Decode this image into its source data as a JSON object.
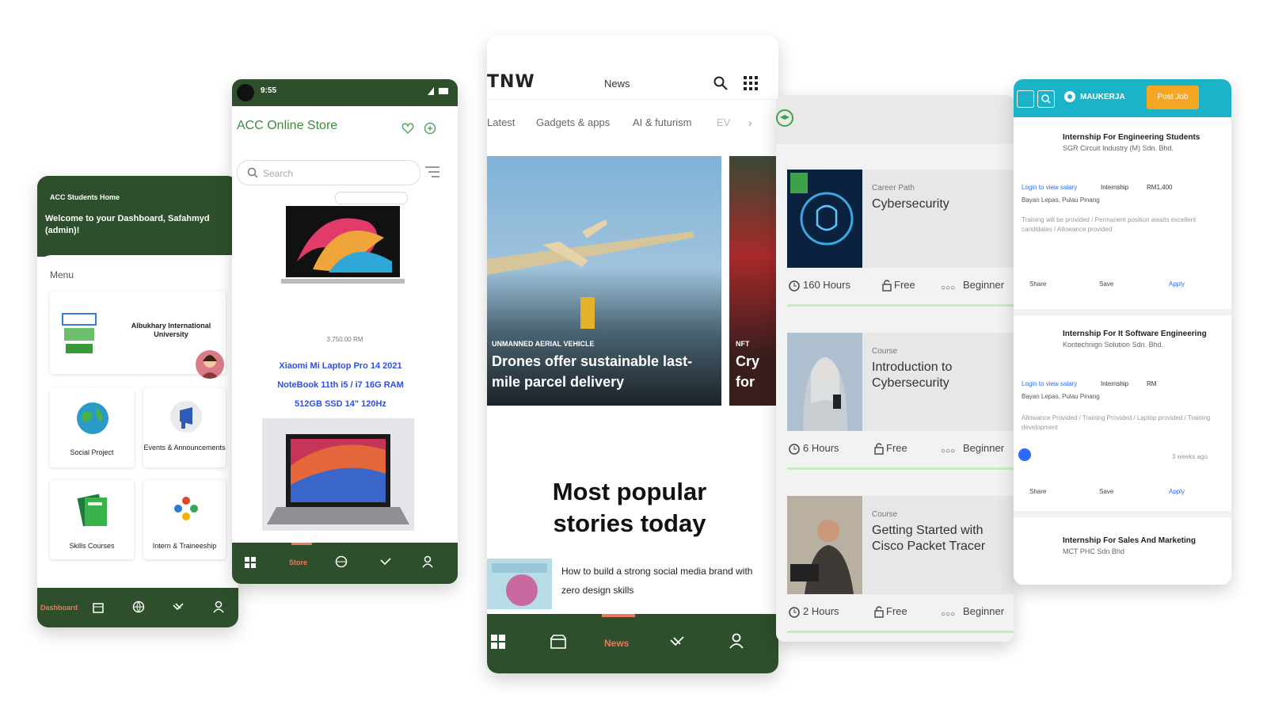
{
  "phone1": {
    "header_small": "ACC Students Home",
    "welcome": "Welcome to your Dashboard, Safahmyd (admin)!",
    "menu_label": "Menu",
    "university_logo_text": "Albukhary International University",
    "tiles": [
      {
        "label": "Social Project"
      },
      {
        "label": "Events & Announcements"
      },
      {
        "label": "Skills Courses"
      },
      {
        "label": "Intern & Traineeship"
      }
    ],
    "nav_active": "Dashboard"
  },
  "phone2": {
    "status_time": "9:55",
    "store_title": "ACC Online Store",
    "search_placeholder": "Search",
    "product_price": "3,750.00 RM",
    "product_name": "Xiaomi Mi Laptop Pro 14 2021 NoteBook 11th i5 / i7 16G RAM 512GB SSD 14\" 120Hz",
    "nav_active": "Store"
  },
  "phone3": {
    "logo": "TNW",
    "header": "News",
    "tabs": [
      "Latest",
      "Gadgets & apps",
      "AI & futurism",
      "EV"
    ],
    "hero_tag": "UNMANNED AERIAL VEHICLE",
    "hero_title": "Drones offer sustainable last-mile parcel delivery",
    "second_tag": "NFT",
    "second_title": "Cry for",
    "popular_heading": "Most popular stories today",
    "story_title": "How to build a strong social media brand with zero design skills",
    "nav_active": "News"
  },
  "phone4": {
    "courses": [
      {
        "type": "Career Path",
        "title": "Cybersecurity",
        "hours": "160 Hours",
        "price": "Free",
        "level": "Beginner"
      },
      {
        "type": "Course",
        "title": "Introduction to Cybersecurity",
        "hours": "6 Hours",
        "price": "Free",
        "level": "Beginner"
      },
      {
        "type": "Course",
        "title": "Getting Started with Cisco Packet Tracer",
        "hours": "2 Hours",
        "price": "Free",
        "level": "Beginner"
      }
    ]
  },
  "phone5": {
    "brand": "MAUKERJA",
    "post_button": "Post Job",
    "jobs": [
      {
        "title": "Internship For Engineering Students",
        "company": "SGR Circuit Industry (M) Sdn. Bhd.",
        "salary": "Login to view salary",
        "type": "Internship",
        "count": "RM1,400",
        "location": "Bayan Lepas, Pulau Pinang",
        "desc": "Training will be provided / Permanent position awaits excellent candidates / Allowance provided",
        "age": ""
      },
      {
        "title": "Internship For It Software Engineering",
        "company": "Kontechnign Solution Sdn. Bhd.",
        "salary": "Login to view salary",
        "type": "Internship",
        "count": "RM",
        "location": "Bayan Lepas, Pulau Pinang",
        "desc": "Allowance Provided / Training Provided / Laptop provided / Training development",
        "age": "3 weeks ago"
      },
      {
        "title": "Internship For Sales And Marketing",
        "company": "MCT PHC Sdn Bhd",
        "salary": "",
        "type": "",
        "count": "",
        "location": "",
        "desc": "",
        "age": ""
      }
    ],
    "actions": [
      "Share",
      "Save",
      "Apply"
    ]
  },
  "colors": {
    "app_green": "#2d4f2b",
    "accent_orange": "#e77a5f",
    "link_blue": "#2f6bff",
    "teal": "#1bb3c7"
  }
}
